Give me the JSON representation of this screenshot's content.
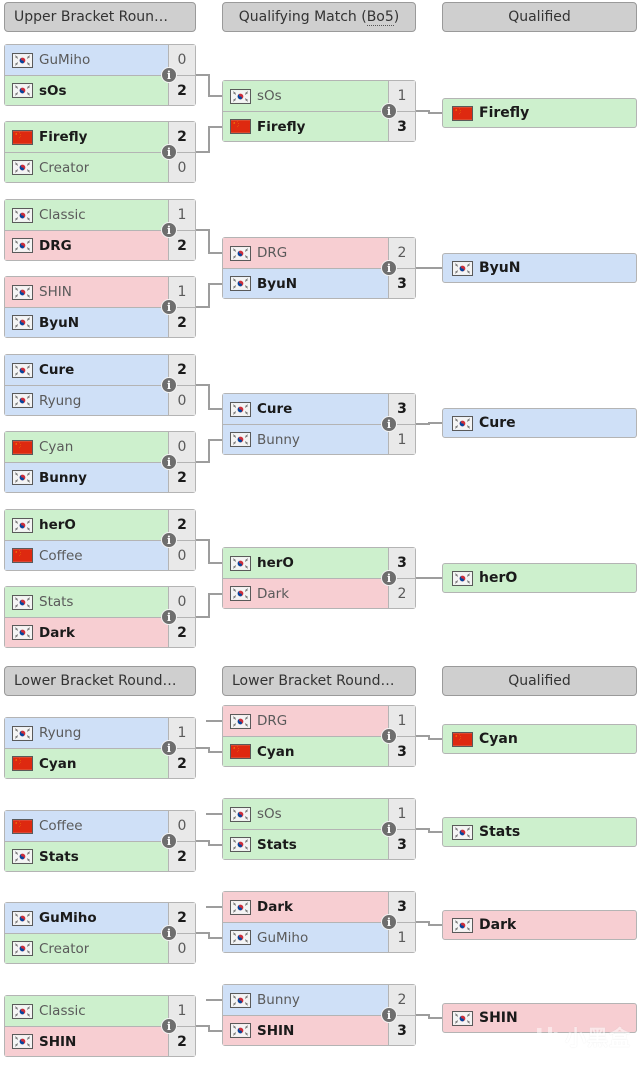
{
  "colors": {
    "terran": "#cfe0f7",
    "protoss": "#cdf0cd",
    "zerg": "#f7ced2",
    "header_bg": "#cfcfcf",
    "score_bg": "#e9e9e9",
    "line": "#9d9d9d",
    "border": "#b4b4b4"
  },
  "headers": [
    {
      "id": "ub-r1",
      "label": "Upper Bracket Roun…"
    },
    {
      "id": "qm",
      "label": "Qualifying Match (",
      "suffix_dotted": "Bo5",
      "suffix_end": ")"
    },
    {
      "id": "qual-1",
      "label": "Qualified"
    },
    {
      "id": "lb-r1",
      "label": "Lower Bracket Round…"
    },
    {
      "id": "lb-r2",
      "label": "Lower Bracket Round…"
    },
    {
      "id": "qual-2",
      "label": "Qualified"
    }
  ],
  "info_label": "i",
  "upper_bracket_round1": [
    {
      "top": {
        "name": "GuMiho",
        "flag": "kr",
        "score": "0",
        "race": "terran",
        "winner": false
      },
      "bottom": {
        "name": "sOs",
        "flag": "kr",
        "score": "2",
        "race": "protoss",
        "winner": true
      }
    },
    {
      "top": {
        "name": "Firefly",
        "flag": "cn",
        "score": "2",
        "race": "protoss",
        "winner": true
      },
      "bottom": {
        "name": "Creator",
        "flag": "kr",
        "score": "0",
        "race": "protoss",
        "winner": false
      }
    },
    {
      "top": {
        "name": "Classic",
        "flag": "kr",
        "score": "1",
        "race": "protoss",
        "winner": false
      },
      "bottom": {
        "name": "DRG",
        "flag": "kr",
        "score": "2",
        "race": "zerg",
        "winner": true
      }
    },
    {
      "top": {
        "name": "SHIN",
        "flag": "kr",
        "score": "1",
        "race": "zerg",
        "winner": false
      },
      "bottom": {
        "name": "ByuN",
        "flag": "kr",
        "score": "2",
        "race": "terran",
        "winner": true
      }
    },
    {
      "top": {
        "name": "Cure",
        "flag": "kr",
        "score": "2",
        "race": "terran",
        "winner": true
      },
      "bottom": {
        "name": "Ryung",
        "flag": "kr",
        "score": "0",
        "race": "terran",
        "winner": false
      }
    },
    {
      "top": {
        "name": "Cyan",
        "flag": "cn",
        "score": "0",
        "race": "protoss",
        "winner": false
      },
      "bottom": {
        "name": "Bunny",
        "flag": "kr",
        "score": "2",
        "race": "terran",
        "winner": true
      }
    },
    {
      "top": {
        "name": "herO",
        "flag": "kr",
        "score": "2",
        "race": "protoss",
        "winner": true
      },
      "bottom": {
        "name": "Coffee",
        "flag": "cn",
        "score": "0",
        "race": "terran",
        "winner": false
      }
    },
    {
      "top": {
        "name": "Stats",
        "flag": "kr",
        "score": "0",
        "race": "protoss",
        "winner": false
      },
      "bottom": {
        "name": "Dark",
        "flag": "kr",
        "score": "2",
        "race": "zerg",
        "winner": true
      }
    }
  ],
  "qualifying_matches": [
    {
      "top": {
        "name": "sOs",
        "flag": "kr",
        "score": "1",
        "race": "protoss",
        "winner": false
      },
      "bottom": {
        "name": "Firefly",
        "flag": "cn",
        "score": "3",
        "race": "protoss",
        "winner": true
      }
    },
    {
      "top": {
        "name": "DRG",
        "flag": "kr",
        "score": "2",
        "race": "zerg",
        "winner": false
      },
      "bottom": {
        "name": "ByuN",
        "flag": "kr",
        "score": "3",
        "race": "terran",
        "winner": true
      }
    },
    {
      "top": {
        "name": "Cure",
        "flag": "kr",
        "score": "3",
        "race": "terran",
        "winner": true
      },
      "bottom": {
        "name": "Bunny",
        "flag": "kr",
        "score": "1",
        "race": "terran",
        "winner": false
      }
    },
    {
      "top": {
        "name": "herO",
        "flag": "kr",
        "score": "3",
        "race": "protoss",
        "winner": true
      },
      "bottom": {
        "name": "Dark",
        "flag": "kr",
        "score": "2",
        "race": "zerg",
        "winner": false
      }
    }
  ],
  "qualified_upper": [
    {
      "name": "Firefly",
      "flag": "cn",
      "race": "protoss"
    },
    {
      "name": "ByuN",
      "flag": "kr",
      "race": "terran"
    },
    {
      "name": "Cure",
      "flag": "kr",
      "race": "terran"
    },
    {
      "name": "herO",
      "flag": "kr",
      "race": "protoss"
    }
  ],
  "lower_bracket_round1": [
    {
      "top": {
        "name": "Ryung",
        "flag": "kr",
        "score": "1",
        "race": "terran",
        "winner": false
      },
      "bottom": {
        "name": "Cyan",
        "flag": "cn",
        "score": "2",
        "race": "protoss",
        "winner": true
      }
    },
    {
      "top": {
        "name": "Coffee",
        "flag": "cn",
        "score": "0",
        "race": "terran",
        "winner": false
      },
      "bottom": {
        "name": "Stats",
        "flag": "kr",
        "score": "2",
        "race": "protoss",
        "winner": true
      }
    },
    {
      "top": {
        "name": "GuMiho",
        "flag": "kr",
        "score": "2",
        "race": "terran",
        "winner": true
      },
      "bottom": {
        "name": "Creator",
        "flag": "kr",
        "score": "0",
        "race": "protoss",
        "winner": false
      }
    },
    {
      "top": {
        "name": "Classic",
        "flag": "kr",
        "score": "1",
        "race": "protoss",
        "winner": false
      },
      "bottom": {
        "name": "SHIN",
        "flag": "kr",
        "score": "2",
        "race": "zerg",
        "winner": true
      }
    }
  ],
  "lower_bracket_round2": [
    {
      "top": {
        "name": "DRG",
        "flag": "kr",
        "score": "1",
        "race": "zerg",
        "winner": false
      },
      "bottom": {
        "name": "Cyan",
        "flag": "cn",
        "score": "3",
        "race": "protoss",
        "winner": true
      }
    },
    {
      "top": {
        "name": "sOs",
        "flag": "kr",
        "score": "1",
        "race": "protoss",
        "winner": false
      },
      "bottom": {
        "name": "Stats",
        "flag": "kr",
        "score": "3",
        "race": "protoss",
        "winner": true
      }
    },
    {
      "top": {
        "name": "Dark",
        "flag": "kr",
        "score": "3",
        "race": "zerg",
        "winner": true
      },
      "bottom": {
        "name": "GuMiho",
        "flag": "kr",
        "score": "1",
        "race": "terran",
        "winner": false
      }
    },
    {
      "top": {
        "name": "Bunny",
        "flag": "kr",
        "score": "2",
        "race": "terran",
        "winner": false
      },
      "bottom": {
        "name": "SHIN",
        "flag": "kr",
        "score": "3",
        "race": "zerg",
        "winner": true
      }
    }
  ],
  "qualified_lower": [
    {
      "name": "Cyan",
      "flag": "cn",
      "race": "protoss"
    },
    {
      "name": "Stats",
      "flag": "kr",
      "race": "protoss"
    },
    {
      "name": "Dark",
      "flag": "kr",
      "race": "zerg"
    },
    {
      "name": "SHIN",
      "flag": "kr",
      "race": "zerg"
    }
  ],
  "watermark": {
    "text": "小黑盒"
  }
}
